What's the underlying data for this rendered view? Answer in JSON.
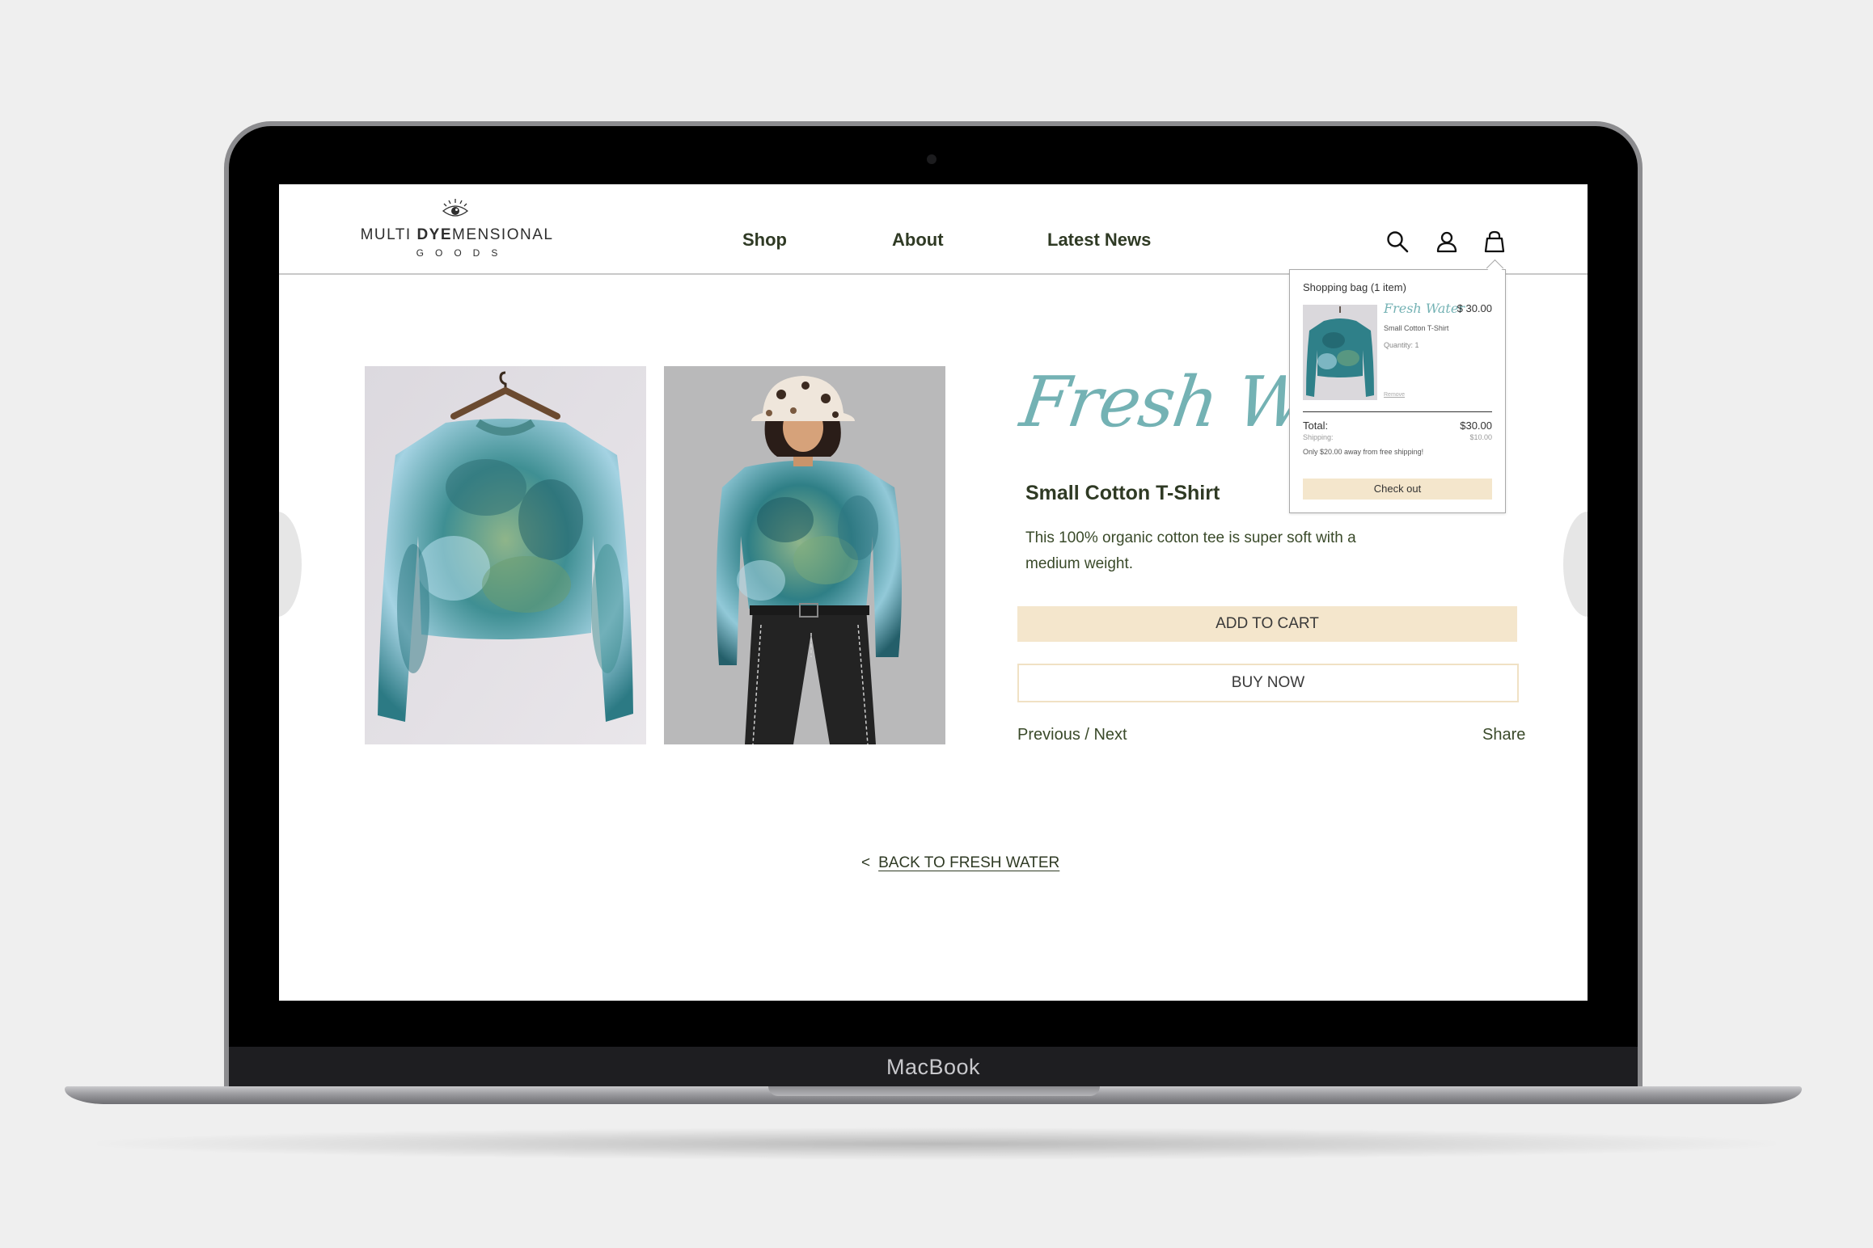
{
  "device": {
    "label": "MacBook"
  },
  "brand": {
    "line1_a": "MULTI",
    "line1_b": "DYE",
    "line1_c": "MENSIONAL",
    "line2": "GOODS"
  },
  "nav": {
    "items": [
      {
        "label": "Shop"
      },
      {
        "label": "About"
      },
      {
        "label": "Latest News"
      }
    ]
  },
  "header_icons": [
    "search-icon",
    "account-icon",
    "shopping-bag-icon"
  ],
  "product": {
    "collection_title": "Fresh Water",
    "name": "Small Cotton T-Shirt",
    "description": "This 100% organic cotton tee is super soft with a medium weight.",
    "add_to_cart_label": "ADD TO CART",
    "buy_now_label": "BUY NOW",
    "prev_next_label": "Previous / Next",
    "share_label": "Share",
    "back_label": "BACK TO FRESH WATER",
    "back_chevron": "<"
  },
  "bag": {
    "heading": "Shopping bag (1 item)",
    "item_title": "Fresh Water",
    "item_price": "$ 30.00",
    "item_variant": "Small Cotton T-Shirt",
    "item_qty": "Quantity: 1",
    "remove_label": "Remove",
    "total_label": "Total:",
    "total_value": "$30.00",
    "shipping_label": "Shipping:",
    "shipping_value": "$10.00",
    "note": "Only $20.00 away from free shipping!",
    "checkout_label": "Check out"
  },
  "colors": {
    "accent_teal": "#74b2b4",
    "button_cream": "#f4e6cc",
    "text_olive": "#2f3a24"
  }
}
